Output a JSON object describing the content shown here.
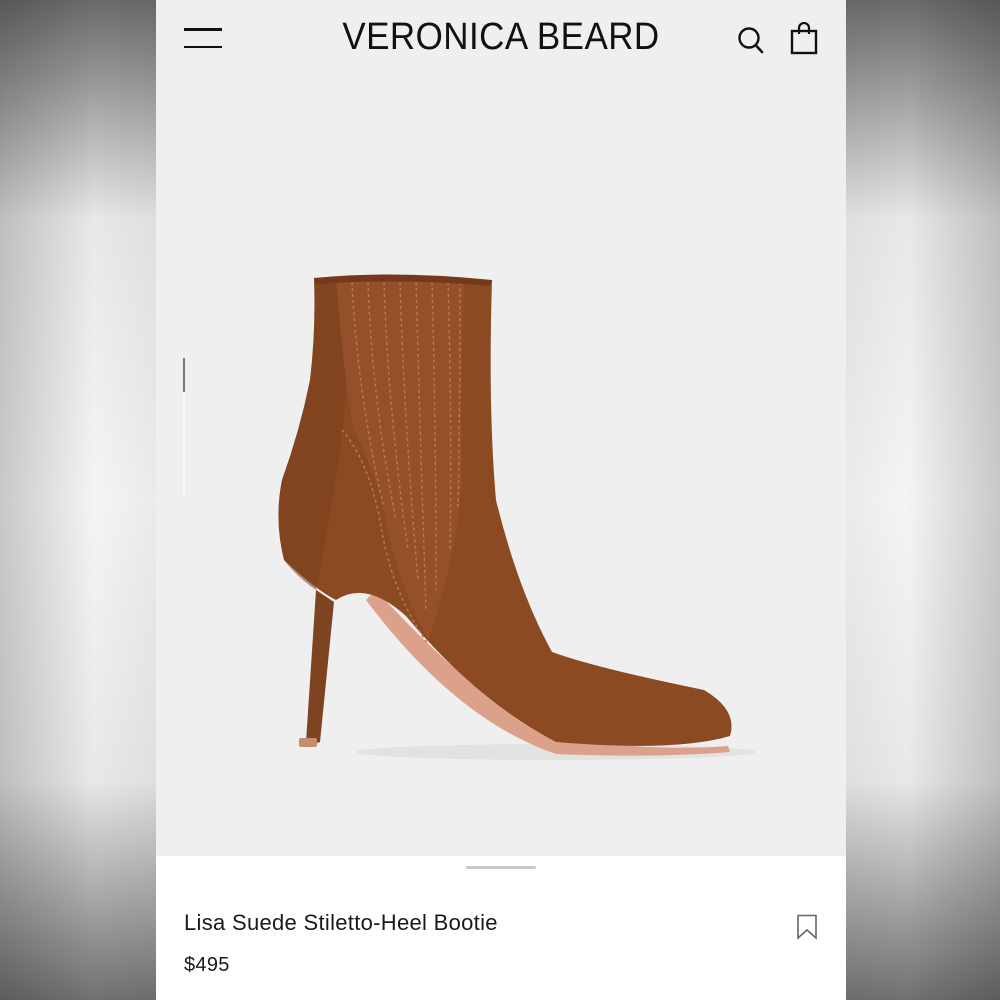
{
  "header": {
    "brand": "VERONICA BEARD",
    "menu_icon": "hamburger-menu-icon",
    "search_icon": "search-icon",
    "bag_icon": "shopping-bag-icon"
  },
  "gallery": {
    "image": "suede stiletto ankle bootie",
    "product_color": "#8c4a22",
    "background_color": "#efefef"
  },
  "product": {
    "name": "Lisa Suede Stiletto-Heel Bootie",
    "price": "$495",
    "bookmark_icon": "bookmark-icon"
  }
}
